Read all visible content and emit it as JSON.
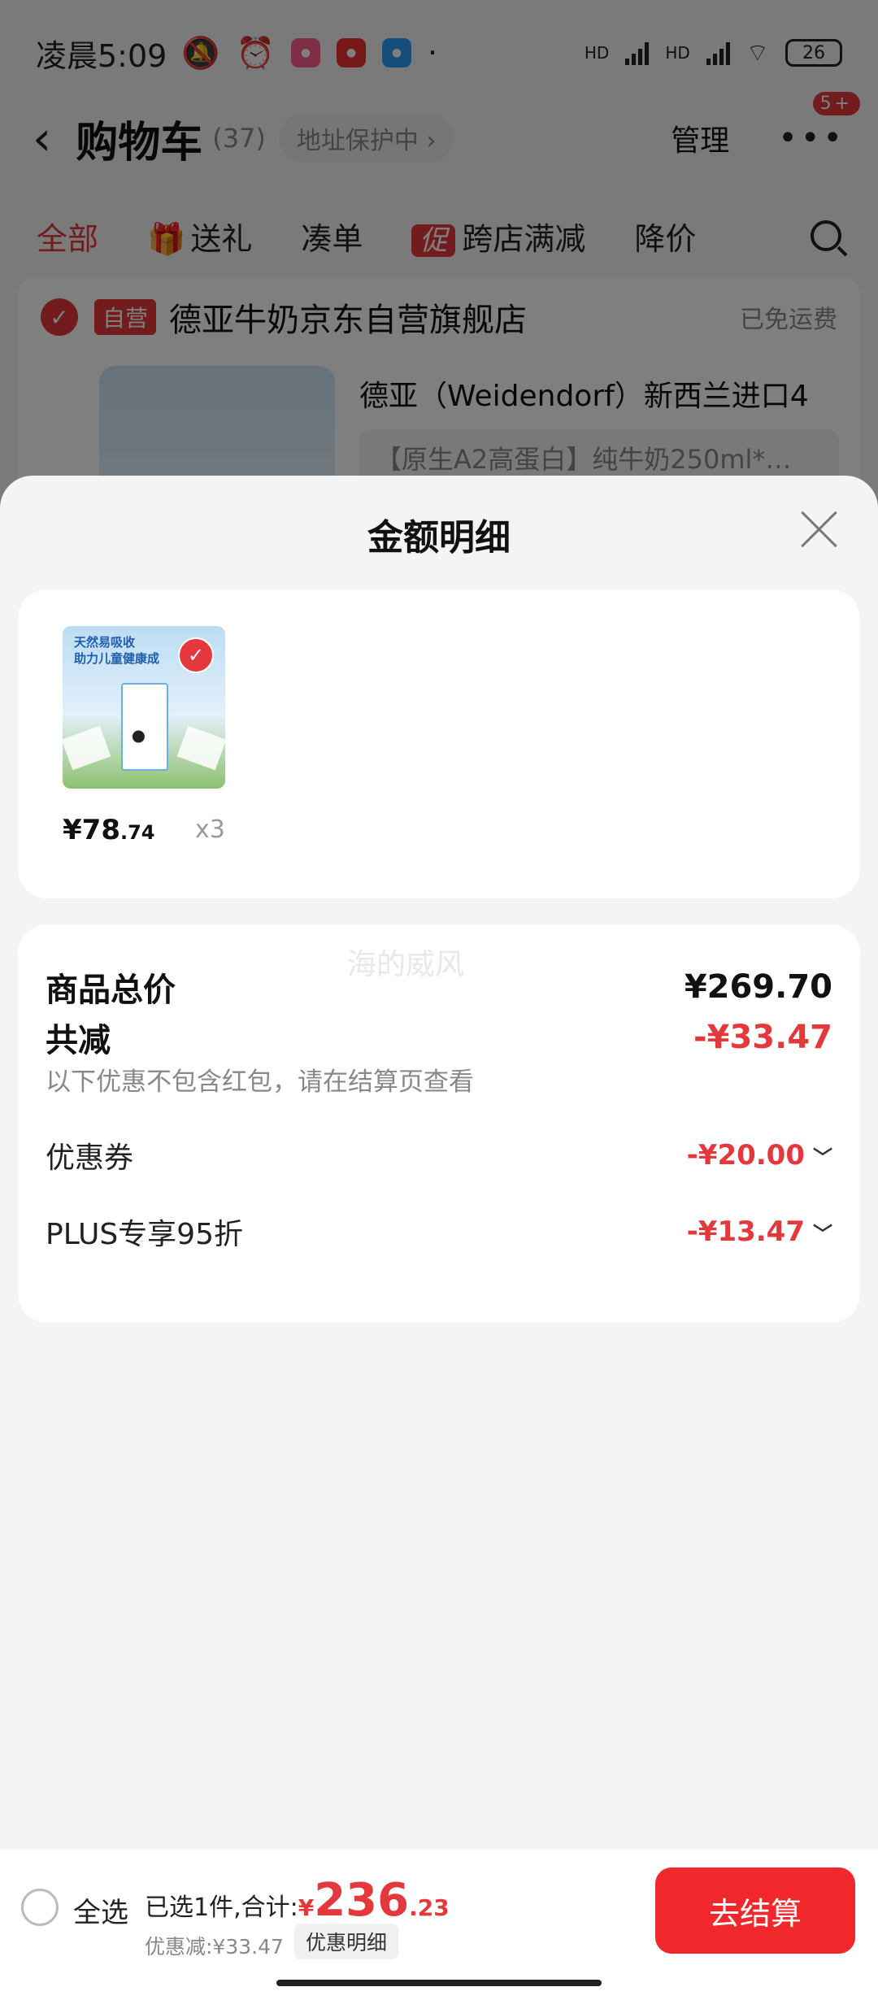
{
  "status_bar": {
    "time": "凌晨5:09",
    "network_1": "HD",
    "network_2": "HD",
    "battery": "26"
  },
  "nav": {
    "title": "购物车",
    "count": "(37)",
    "address_status": "地址保护中",
    "manage": "管理",
    "more_badge": "5+"
  },
  "tabs": [
    {
      "label": "全部"
    },
    {
      "label": "送礼"
    },
    {
      "label": "凑单"
    },
    {
      "label": "跨店满减",
      "tag": "促"
    },
    {
      "label": "降价"
    }
  ],
  "store": {
    "tag": "自营",
    "name": "德亚牛奶京东自营旗舰店",
    "shipping": "已免运费"
  },
  "product_bg": {
    "title": "德亚（Weidendorf）新西兰进口4",
    "spec": "【原生A2高蛋白】纯牛奶250ml*…"
  },
  "sheet": {
    "title": "金额明细",
    "item": {
      "thumb_text_1": "天然易吸收",
      "thumb_text_2": "助力儿童健康成",
      "price_int": "¥78",
      "price_dec": ".74",
      "qty": "x3"
    },
    "watermark": "海的威风",
    "summary": {
      "total_label": "商品总价",
      "total_value": "¥269.70",
      "reduce_label": "共减",
      "reduce_value": "-¥33.47",
      "note": "以下优惠不包含红包，请在结算页查看",
      "coupon_label": "优惠券",
      "coupon_value": "-¥20.00",
      "plus_label": "PLUS专享95折",
      "plus_value": "-¥13.47"
    }
  },
  "checkout": {
    "select_all": "全选",
    "selected_text": "已选1件,合计:",
    "currency": "¥",
    "total_int": "236",
    "total_dec": ".23",
    "discount_text": "优惠减:¥33.47",
    "detail_chip": "优惠明细",
    "button": "去结算"
  },
  "colors": {
    "accent": "#e4393c",
    "checkout_button": "#f0272b",
    "sheet_bg": "#f4f4f4"
  },
  "icons": [
    "back-icon",
    "more-icon",
    "gift-icon",
    "search-icon",
    "close-icon",
    "check-icon",
    "chevron-down-icon"
  ]
}
